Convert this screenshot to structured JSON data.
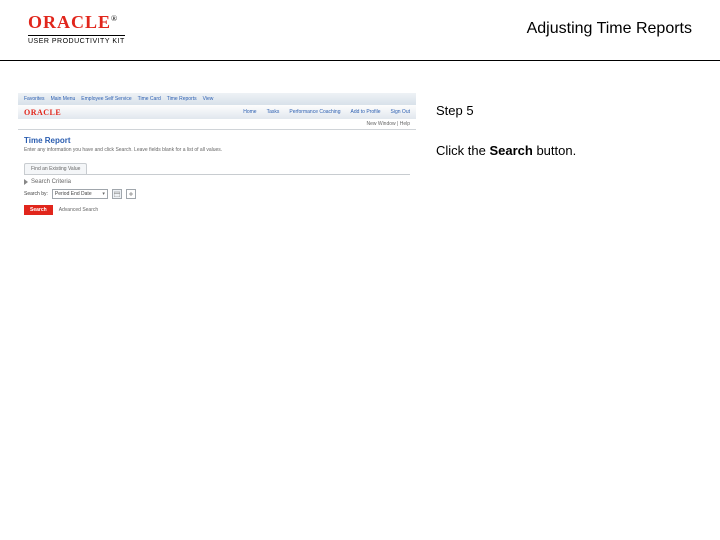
{
  "header": {
    "brand": "ORACLE",
    "trademark": "®",
    "subline": "USER PRODUCTIVITY KIT",
    "title": "Adjusting Time Reports"
  },
  "shot": {
    "topbar": {
      "t0": "Favorites",
      "t1": "Main Menu",
      "t2": "Employee Self Service",
      "t3": "Time Card",
      "t4": "Time Reports",
      "t5": "View"
    },
    "nav": {
      "logo": "ORACLE",
      "l0": "Home",
      "l1": "Tasks",
      "l2": "Performance Coaching",
      "l3": "Add to Profile",
      "l4": "Sign Out"
    },
    "subbar": "New Window | Help",
    "sectionTitle": "Time Report",
    "sectionDesc": "Enter any information you have and click Search. Leave fields blank for a list of all values.",
    "tab": "Find an Existing Value",
    "collapse": "Search Criteria",
    "searchByLabel": "Search by:",
    "dropdown": "Period End Date",
    "searchBtn": "Search",
    "advanced": "Advanced Search"
  },
  "step": {
    "label": "Step 5",
    "textBefore": "Click the ",
    "bold": "Search",
    "textAfter": " button."
  }
}
